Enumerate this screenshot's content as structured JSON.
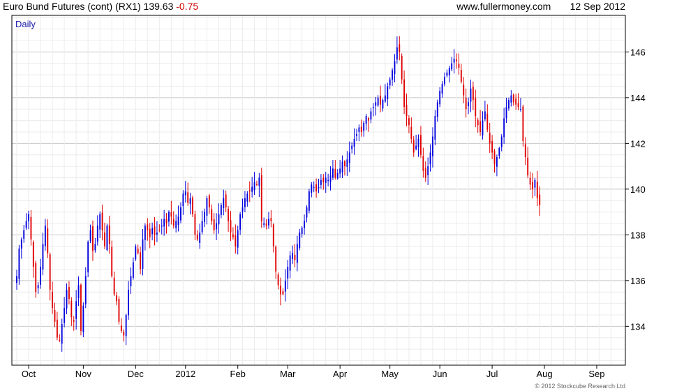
{
  "header": {
    "instrument": "Euro Bund Futures (cont) (RX1)",
    "price": "139.63",
    "change": "-0.75",
    "site": "www.fullermoney.com",
    "date": "12 Sep 2012"
  },
  "footer": {
    "copyright": "© 2012 Stockcube Research Ltd"
  },
  "colors": {
    "up": "#0000dd",
    "down": "#e00000",
    "grid": "#d8d8d8",
    "frame": "#000000"
  },
  "chart_data": {
    "type": "candlestick",
    "interval_label": "Daily",
    "ylim": [
      132.3,
      147.6
    ],
    "yticks": [
      134,
      136,
      138,
      140,
      142,
      144,
      146
    ],
    "month_ticks": [
      {
        "label": "Oct",
        "index": 5
      },
      {
        "label": "Nov",
        "index": 28
      },
      {
        "label": "Dec",
        "index": 50
      },
      {
        "label": "2012",
        "index": 71
      },
      {
        "label": "Feb",
        "index": 93
      },
      {
        "label": "Mar",
        "index": 114
      },
      {
        "label": "Apr",
        "index": 136
      },
      {
        "label": "May",
        "index": 157
      },
      {
        "label": "Jun",
        "index": 178
      },
      {
        "label": "Jul",
        "index": 200
      },
      {
        "label": "Aug",
        "index": 222
      },
      {
        "label": "Sep",
        "index": 244
      }
    ],
    "total_sessions": 255,
    "close_series": [
      136.2,
      137.4,
      137.8,
      138.2,
      138.6,
      138.9,
      137.8,
      136.6,
      135.5,
      135.8,
      136.6,
      137.6,
      138.4,
      137.2,
      135.6,
      134.8,
      134.2,
      133.5,
      133.4,
      134.1,
      134.8,
      135.6,
      135.2,
      134.4,
      134.2,
      135.1,
      135.8,
      133.8,
      134.9,
      136.2,
      137.7,
      138.2,
      137.3,
      137.6,
      138.4,
      138.9,
      138.2,
      137.5,
      138.4,
      137.6,
      136.2,
      135.4,
      135.1,
      134.2,
      133.8,
      133.6,
      134.5,
      135.6,
      136.2,
      136.8,
      137.5,
      137.2,
      136.5,
      137.8,
      138.4,
      138.2,
      137.9,
      138.3,
      138.0,
      138.1,
      138.2,
      138.4,
      138.7,
      138.5,
      139.0,
      138.8,
      138.4,
      138.6,
      138.8,
      139.2,
      139.8,
      139.9,
      139.4,
      139.6,
      138.9,
      138.0,
      137.8,
      138.1,
      138.6,
      139.0,
      139.6,
      139.2,
      138.6,
      138.2,
      138.5,
      138.9,
      139.3,
      139.6,
      139.2,
      138.6,
      138.1,
      137.9,
      137.5,
      138.2,
      138.9,
      139.2,
      139.6,
      139.8,
      139.9,
      140.1,
      140.3,
      140.2,
      140.5,
      138.6,
      138.5,
      138.4,
      138.7,
      138.6,
      137.5,
      136.4,
      135.8,
      135.4,
      135.4,
      136.0,
      136.6,
      137.1,
      137.2,
      136.9,
      137.6,
      138.1,
      138.3,
      138.6,
      139.2,
      139.9,
      140.2,
      140.1,
      139.9,
      140.1,
      140.4,
      140.3,
      140.5,
      140.4,
      140.6,
      140.9,
      140.5,
      140.7,
      140.9,
      141.2,
      141.0,
      141.3,
      141.6,
      141.9,
      142.2,
      142.4,
      142.7,
      142.5,
      142.9,
      143.2,
      143.0,
      143.4,
      143.6,
      143.8,
      144.0,
      143.7,
      143.9,
      144.1,
      144.5,
      144.8,
      145.2,
      145.6,
      146.2,
      146.0,
      144.8,
      143.6,
      143.2,
      142.8,
      142.2,
      141.6,
      141.9,
      142.2,
      141.5,
      140.8,
      140.5,
      141.0,
      141.6,
      142.3,
      143.2,
      143.8,
      144.3,
      144.6,
      144.9,
      145.1,
      145.3,
      145.5,
      145.7,
      145.6,
      145.3,
      144.7,
      144.1,
      143.5,
      143.8,
      144.4,
      143.9,
      143.2,
      142.8,
      142.5,
      143.0,
      143.4,
      142.6,
      142.0,
      141.6,
      141.1,
      141.4,
      141.8,
      142.3,
      143.1,
      143.6,
      143.9,
      144.1,
      143.8,
      143.7,
      143.6,
      143.5,
      142.1,
      141.4,
      140.6,
      140.2,
      140.0,
      140.4,
      139.6,
      139.3
    ]
  }
}
